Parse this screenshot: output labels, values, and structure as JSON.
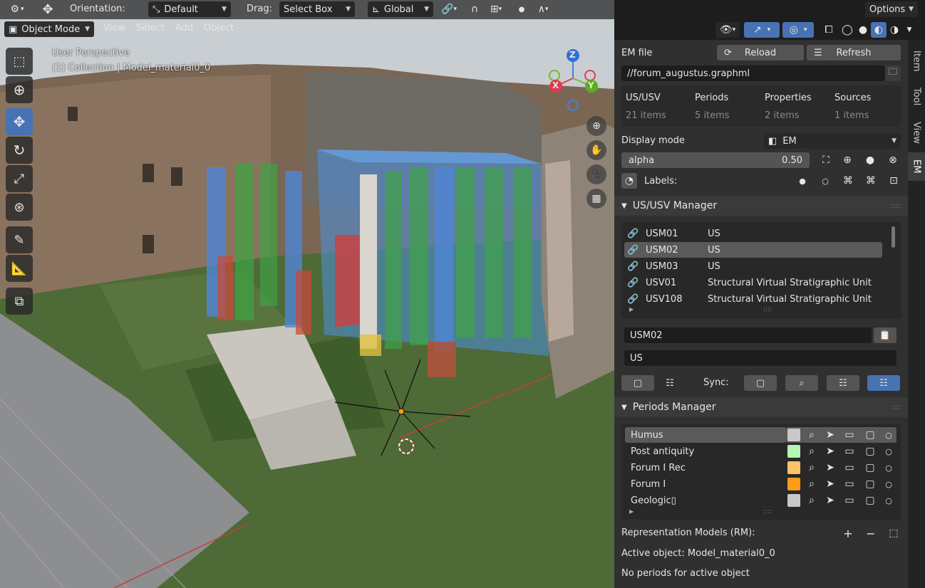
{
  "header": {
    "orientation_label": "Orientation:",
    "orientation_value": "Default",
    "drag_label": "Drag:",
    "drag_value": "Select Box",
    "transform_value": "Global",
    "options_label": "Options"
  },
  "menu": {
    "mode": "Object Mode",
    "items": [
      "View",
      "Select",
      "Add",
      "Object"
    ]
  },
  "viewport": {
    "perspective": "User Perspective",
    "collection": "(1) Collection | Model_material0_0",
    "gizmo": {
      "z": "Z",
      "x": "X",
      "y": "Y"
    }
  },
  "em": {
    "file_label": "EM file",
    "reload": "Reload",
    "refresh": "Refresh",
    "file_path": "//forum_augustus.graphml",
    "stats": [
      {
        "name": "US/USV",
        "count": "21 items"
      },
      {
        "name": "Periods",
        "count": "5 items"
      },
      {
        "name": "Properties",
        "count": "2 items"
      },
      {
        "name": "Sources",
        "count": "1 items"
      }
    ],
    "display_mode_label": "Display mode",
    "display_mode_value": "EM",
    "alpha_label": "alpha",
    "alpha_value": "0.50",
    "labels_label": "Labels:"
  },
  "us_manager": {
    "title": "US/USV Manager",
    "rows": [
      {
        "id": "USM01",
        "type": "US"
      },
      {
        "id": "USM02",
        "type": "US"
      },
      {
        "id": "USM03",
        "type": "US"
      },
      {
        "id": "USV01",
        "type": "Structural Virtual Stratigraphic Unit"
      },
      {
        "id": "USV108",
        "type": "Structural Virtual Stratigraphic Unit"
      }
    ],
    "selected_name": "USM02",
    "selected_type": "US",
    "sync_label": "Sync:"
  },
  "periods": {
    "title": "Periods Manager",
    "rows": [
      {
        "name": "Humus",
        "color": "#c8c8c8"
      },
      {
        "name": "Post antiquity",
        "color": "#b3f5b3"
      },
      {
        "name": "Forum I Rec",
        "color": "#ffc46a"
      },
      {
        "name": "Forum I",
        "color": "#ff9a1a"
      },
      {
        "name": "Geologic▯",
        "color": "#c8c8c8"
      }
    ],
    "rm_label": "Representation Models (RM):",
    "active_object": "Active object: Model_material0_0",
    "no_periods": "No periods for active object"
  },
  "tabs": [
    "Item",
    "Tool",
    "View",
    "EM"
  ],
  "colors": {
    "accent": "#4772b3",
    "panel": "#303030",
    "header": "#3a3a3a"
  }
}
